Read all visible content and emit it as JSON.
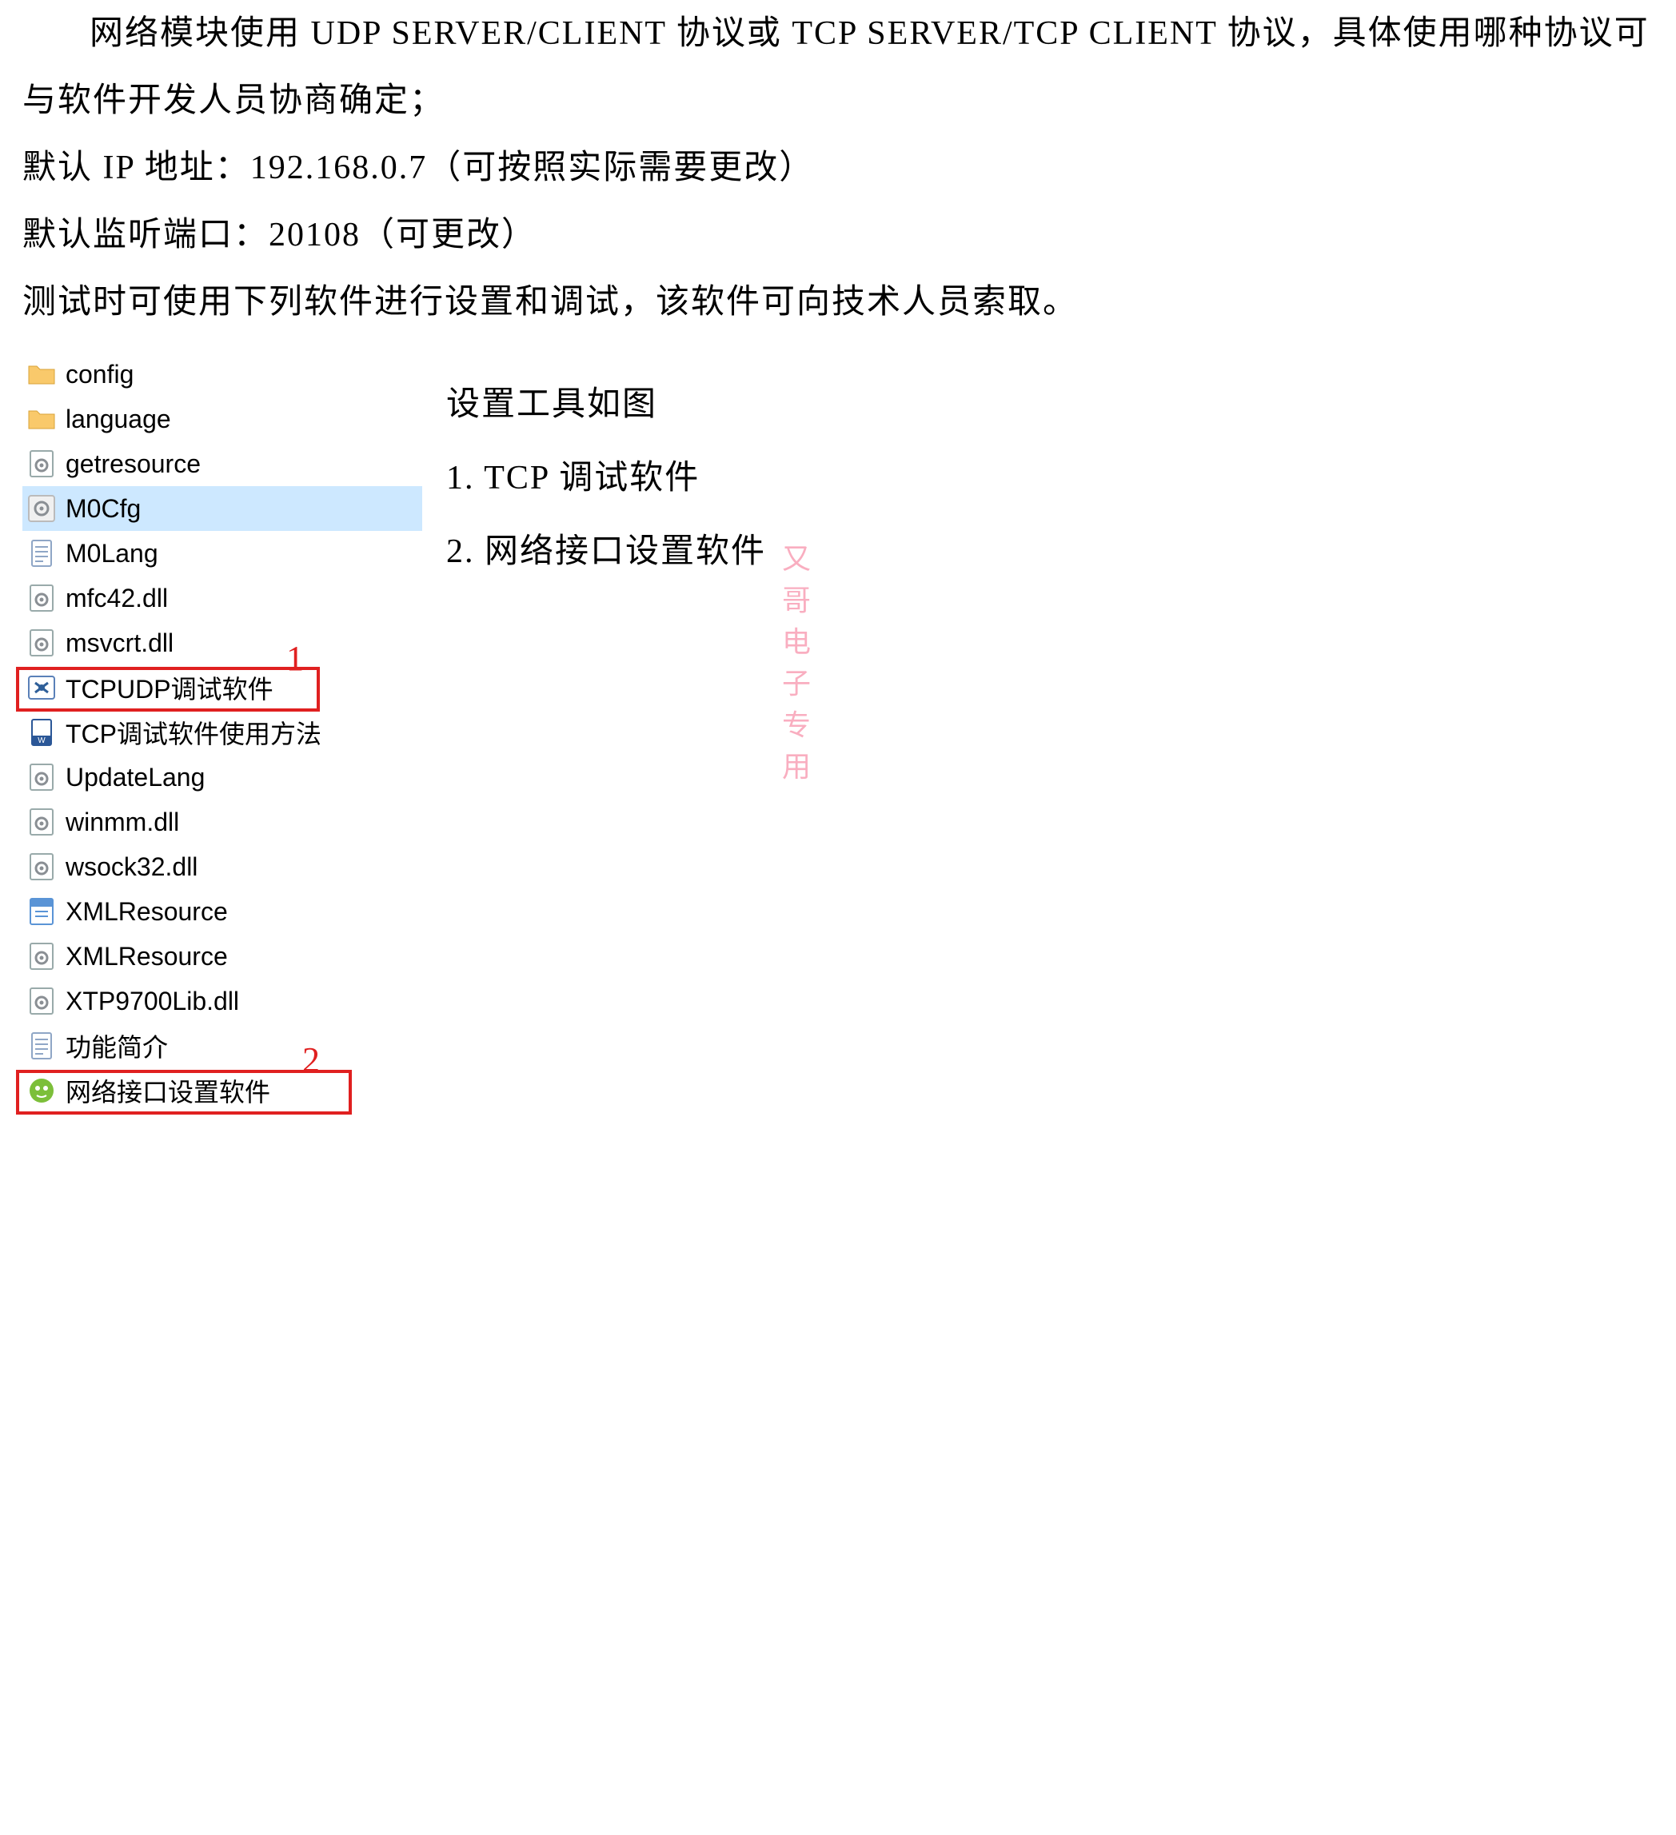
{
  "paragraphs": {
    "p1": "网络模块使用 UDP SERVER/CLIENT 协议或 TCP SERVER/TCP CLIENT 协议，具体使用哪种协议可与软件开发人员协商确定；",
    "p2": "默认 IP 地址：192.168.0.7（可按照实际需要更改）",
    "p3": "默认监听端口：20108（可更改）",
    "p4": "测试时可使用下列软件进行设置和调试，该软件可向技术人员索取。"
  },
  "files": [
    {
      "name": "config",
      "icon": "folder"
    },
    {
      "name": "language",
      "icon": "folder"
    },
    {
      "name": "getresource",
      "icon": "gear-file"
    },
    {
      "name": "M0Cfg",
      "icon": "gear-exe",
      "selected": true
    },
    {
      "name": "M0Lang",
      "icon": "text-file"
    },
    {
      "name": "mfc42.dll",
      "icon": "gear-file"
    },
    {
      "name": "msvcrt.dll",
      "icon": "gear-file"
    },
    {
      "name": "TCPUDP调试软件",
      "icon": "app-blue"
    },
    {
      "name": "TCP调试软件使用方法",
      "icon": "doc"
    },
    {
      "name": "UpdateLang",
      "icon": "gear-file"
    },
    {
      "name": "winmm.dll",
      "icon": "gear-file"
    },
    {
      "name": "wsock32.dll",
      "icon": "gear-file"
    },
    {
      "name": "XMLResource",
      "icon": "xml-file"
    },
    {
      "name": "XMLResource",
      "icon": "gear-file"
    },
    {
      "name": "XTP9700Lib.dll",
      "icon": "gear-file"
    },
    {
      "name": "功能简介",
      "icon": "text-file"
    },
    {
      "name": "网络接口设置软件",
      "icon": "app-green"
    }
  ],
  "annot": {
    "num1": "1",
    "num2": "2"
  },
  "side": {
    "title": "设置工具如图",
    "line1": "1. TCP 调试软件",
    "line2": "2. 网络接口设置软件"
  },
  "watermark": "又哥电子专用"
}
